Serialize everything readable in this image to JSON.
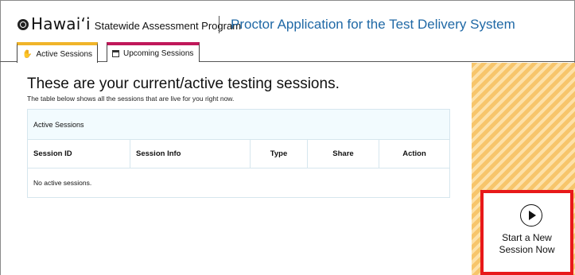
{
  "header": {
    "logo_name": "Hawai‘i",
    "logo_sub": "Statewide Assessment Program",
    "app_title": "Proctor Application for the Test Delivery System"
  },
  "tabs": [
    {
      "label": "Active Sessions",
      "icon": "hand-icon",
      "accent": "#f0b429",
      "selected": true
    },
    {
      "label": "Upcoming Sessions",
      "icon": "calendar-icon",
      "accent": "#c0185a",
      "selected": false
    }
  ],
  "main": {
    "heading": "These are your current/active testing sessions.",
    "subheading": "The table below shows all the sessions that are live for you right now.",
    "table": {
      "title": "Active Sessions",
      "columns": [
        "Session ID",
        "Session Info",
        "Type",
        "Share",
        "Action"
      ],
      "empty_message": "No active sessions."
    }
  },
  "side": {
    "start_line1": "Start a New",
    "start_line2": "Session Now",
    "highlight_color": "#e8191a"
  }
}
